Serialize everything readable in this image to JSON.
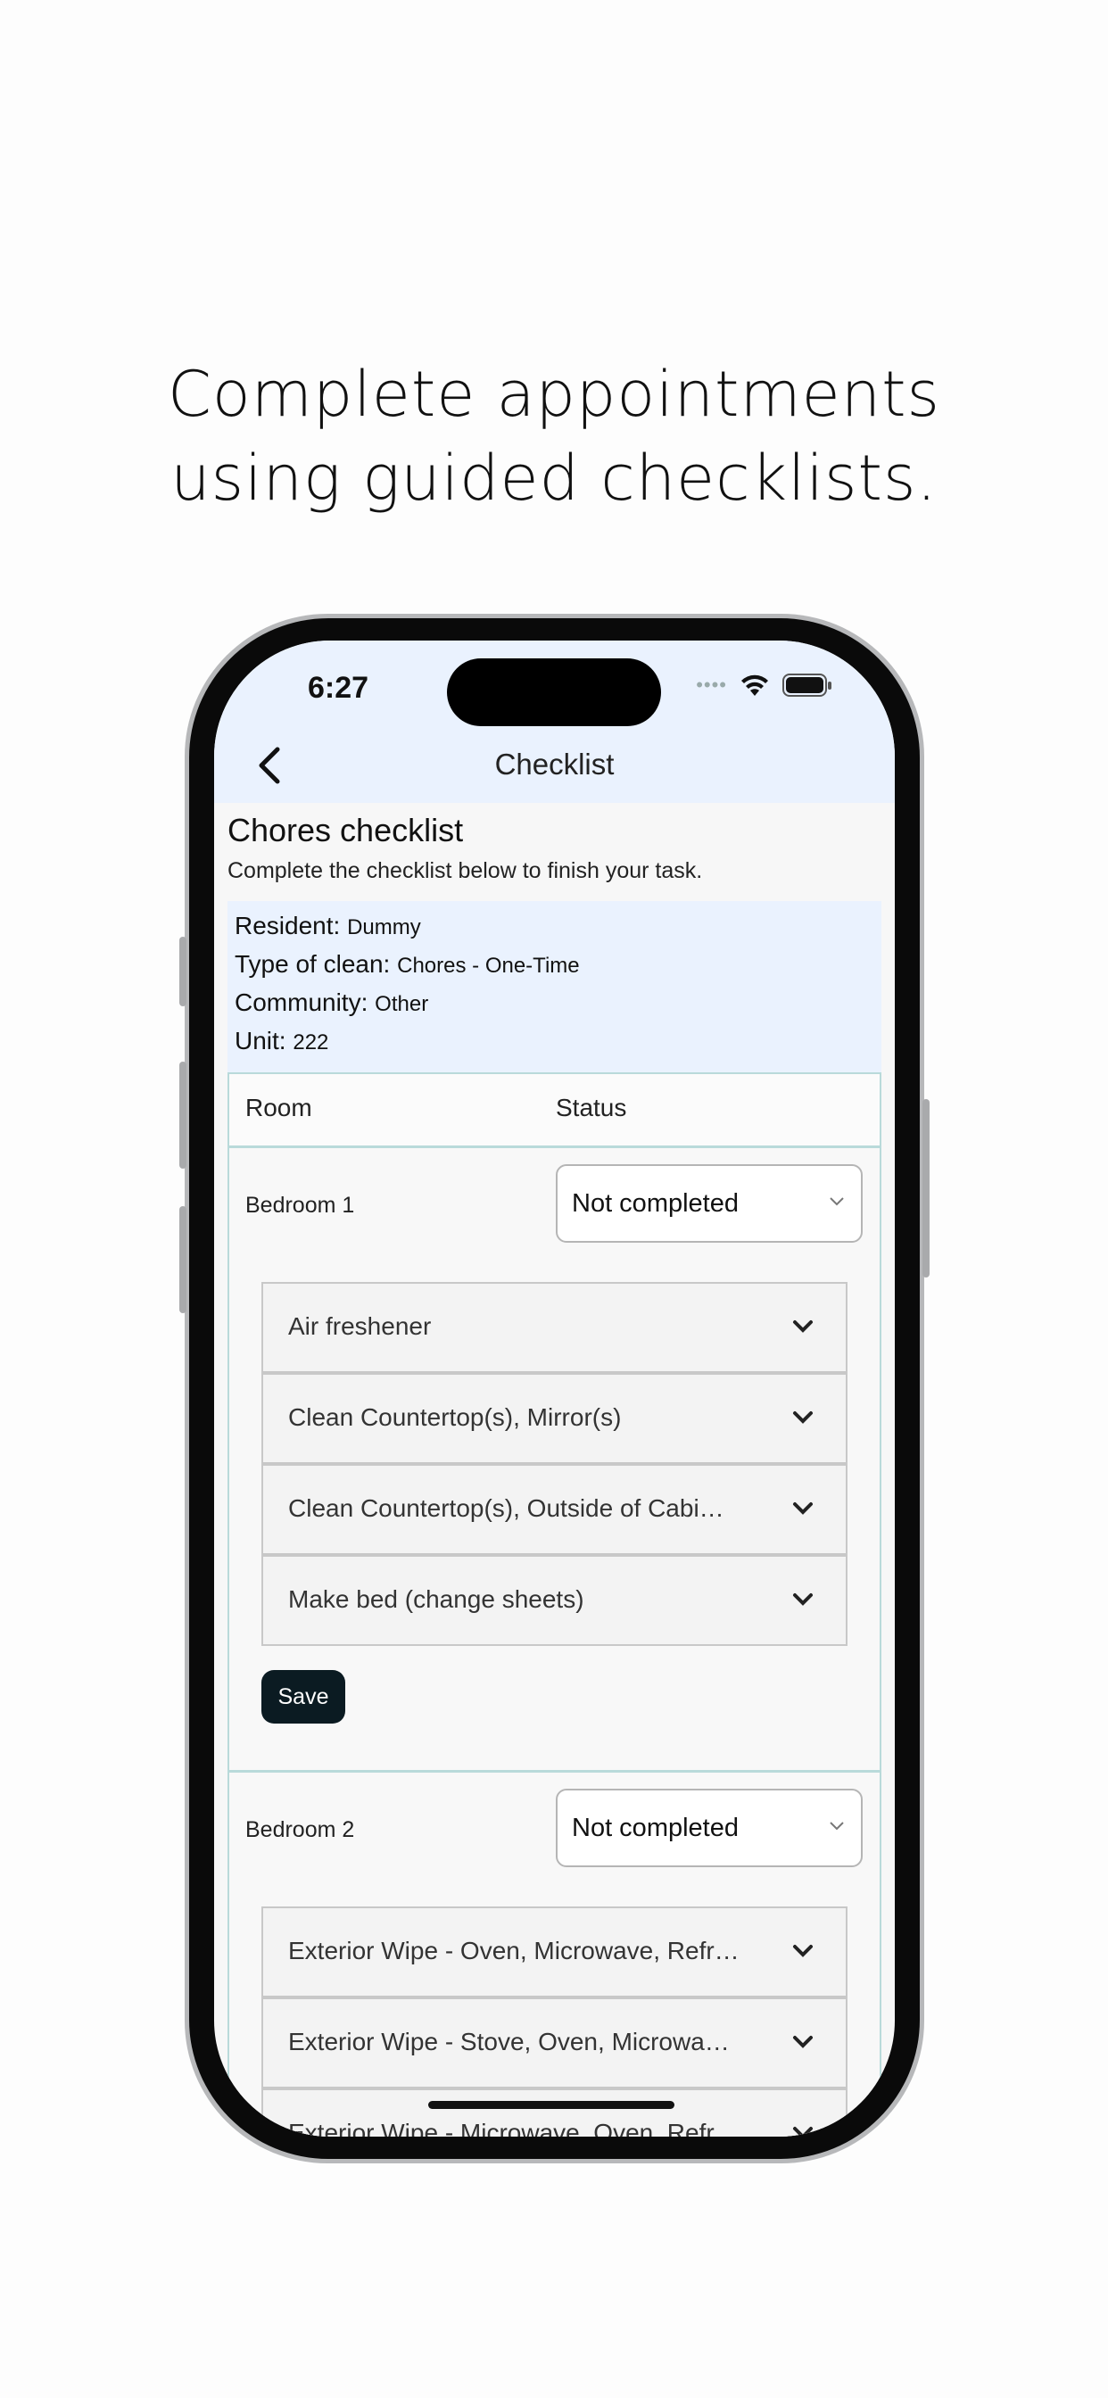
{
  "headline": {
    "line1": "Complete appointments",
    "line2": "using guided checklists."
  },
  "status_bar": {
    "time": "6:27",
    "signal_dots": "••••"
  },
  "nav": {
    "title": "Checklist"
  },
  "page": {
    "title": "Chores checklist",
    "subtitle": "Complete the checklist below to finish your task."
  },
  "info": {
    "resident_label": "Resident:",
    "resident": "Dummy",
    "clean_label": "Type of clean:",
    "clean": "Chores - One-Time",
    "community_label": "Community:",
    "community": "Other",
    "unit_label": "Unit:",
    "unit": "222"
  },
  "table": {
    "headers": {
      "room": "Room",
      "status": "Status"
    },
    "rooms": [
      {
        "name": "Bedroom 1",
        "status": "Not completed",
        "items": [
          "Air freshener",
          "Clean Countertop(s), Mirror(s)",
          "Clean Countertop(s), Outside of Cabi…",
          "Make bed (change sheets)"
        ],
        "save_label": "Save"
      },
      {
        "name": "Bedroom 2",
        "status": "Not completed",
        "items": [
          "Exterior Wipe - Oven, Microwave, Refr…",
          "Exterior Wipe - Stove, Oven, Microwa…",
          "Exterior Wipe - Microwave, Oven, Refr…"
        ]
      }
    ]
  },
  "colors": {
    "nav_bg": "#eaf2fe",
    "border_accent": "#b9dada",
    "save_button": "#0b1b22"
  }
}
